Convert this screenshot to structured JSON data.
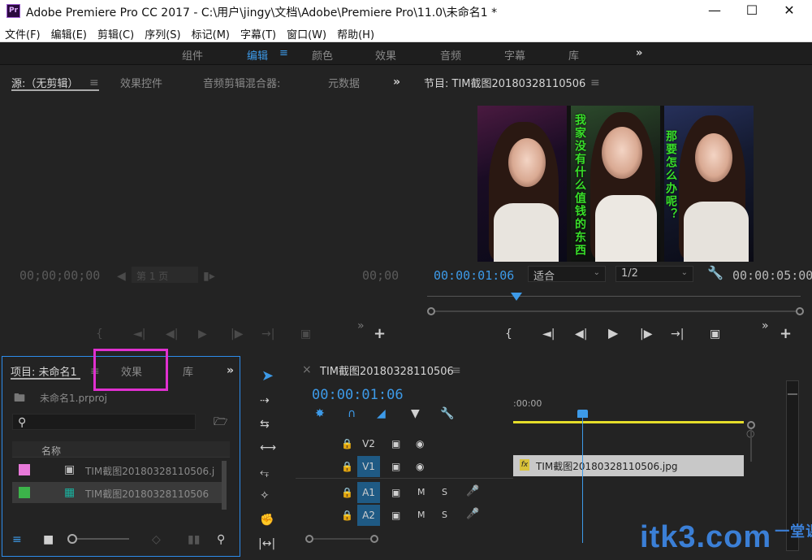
{
  "window": {
    "app_icon": "Pr",
    "title": "Adobe Premiere Pro CC 2017 - C:\\用户\\jingy\\文档\\Adobe\\Premiere Pro\\11.0\\未命名1 *",
    "minimize_icon": "minimize-icon",
    "maximize_icon": "maximize-icon",
    "close_icon": "close-icon"
  },
  "menu": [
    "文件(F)",
    "编辑(E)",
    "剪辑(C)",
    "序列(S)",
    "标记(M)",
    "字幕(T)",
    "窗口(W)",
    "帮助(H)"
  ],
  "workspaces": {
    "items": [
      "组件",
      "编辑",
      "颜色",
      "效果",
      "音频",
      "字幕",
      "库"
    ],
    "active": "编辑",
    "more": "»"
  },
  "source_panel": {
    "tabs": [
      "源:（无剪辑）",
      "效果控件",
      "音频剪辑混合器:",
      "元数据"
    ],
    "more": "»",
    "timecode_in": "00;00;00;00",
    "page_label": "第 1 页",
    "timecode_out": "00;00"
  },
  "program_panel": {
    "title": "节目: TIM截图20180328110506",
    "timecode": "00:00:01:06",
    "fit": "适合",
    "resolution": "1/2",
    "duration": "00:00:05:00",
    "playhead_fraction": 0.24,
    "captions": [
      "我家没有什么值钱的东西",
      "那要怎么办呢？"
    ]
  },
  "project_panel": {
    "tabs": [
      "项目: 未命名1",
      "效果",
      "库"
    ],
    "more": "»",
    "project_file": "未命名1.prproj",
    "search_placeholder": "",
    "column_header": "名称",
    "items": [
      {
        "name": "TIM截图20180328110506.j",
        "color": "#e879d9"
      },
      {
        "name": "TIM截图20180328110506",
        "color": "#3cb34a"
      }
    ],
    "highlight_color": "#e030d0"
  },
  "timeline": {
    "sequence_name": "TIM截图20180328110506",
    "timecode": "00:00:01:06",
    "ruler_start": ":00:00",
    "tracks": [
      "V2",
      "V1",
      "A1",
      "A2"
    ],
    "clip_name": "TIM截图20180328110506.jpg",
    "clip_fx": "fx",
    "mute_label": "M",
    "solo_label": "S",
    "playhead_fraction": 0.3
  },
  "watermark": {
    "text": "itk3",
    "suffix": ".com",
    "cn": "一堂课"
  },
  "colors": {
    "accent": "#2d8ceb",
    "timecode_blue": "#3d9ae8",
    "work_area": "#e5dd2a"
  }
}
